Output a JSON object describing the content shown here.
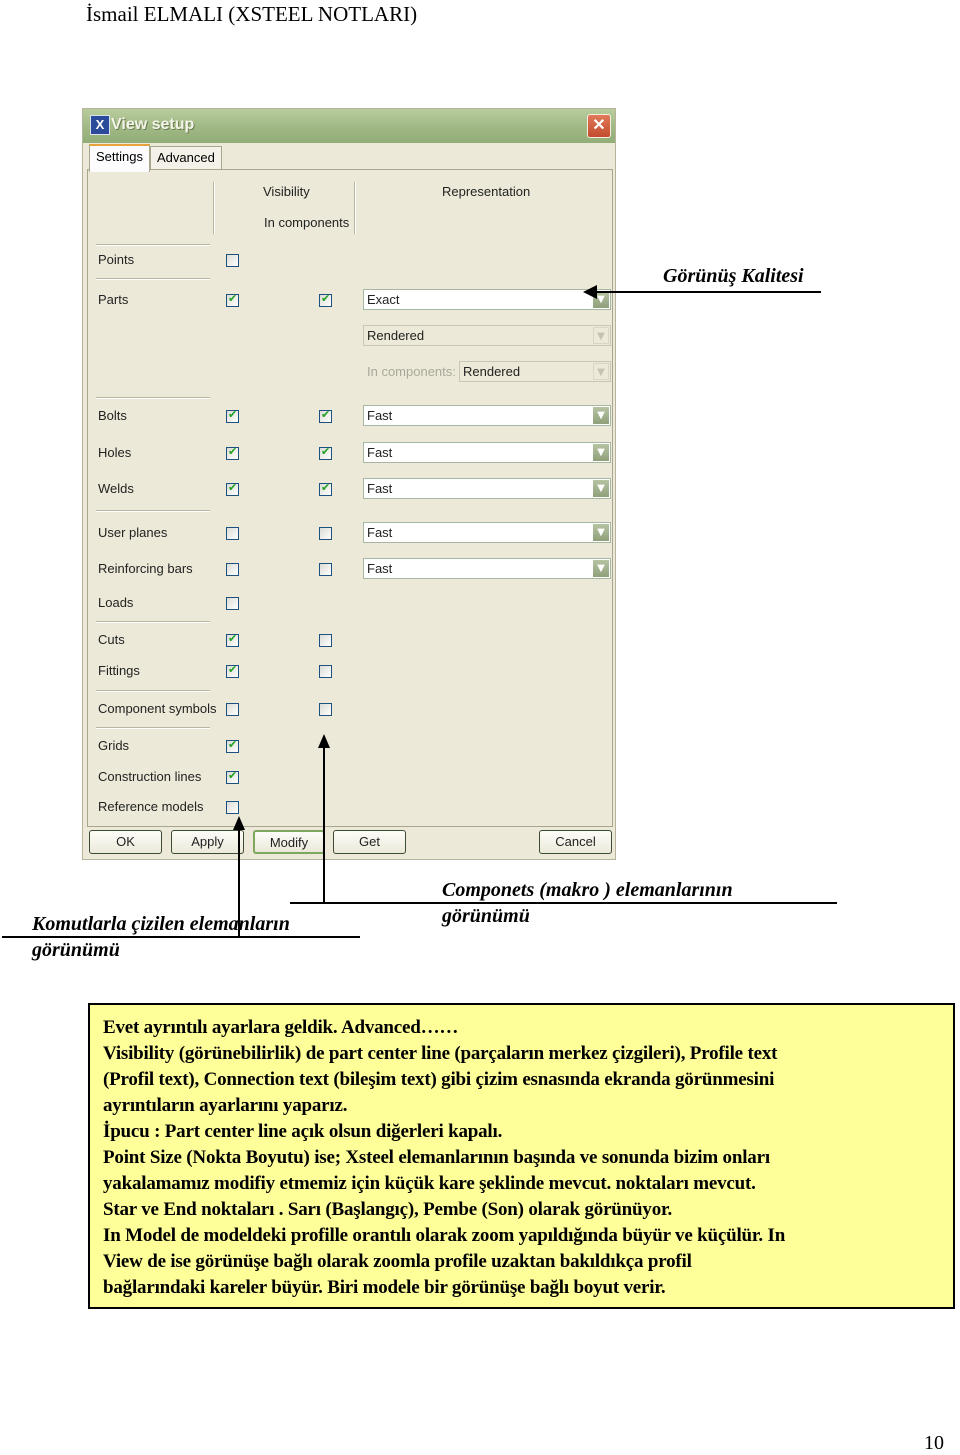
{
  "page": {
    "header": "İsmail ELMALI (XSTEEL NOTLARI)",
    "page_number": "10"
  },
  "dialog": {
    "title": "View setup",
    "app_icon": "xsteel-app-icon",
    "close_glyph": "✕",
    "tabs": [
      {
        "label": "Settings",
        "active": true
      },
      {
        "label": "Advanced",
        "active": false
      }
    ],
    "columns": {
      "visibility": "Visibility",
      "in_components": "In components",
      "representation": "Representation"
    },
    "rows": [
      {
        "label": "Points",
        "visible": false,
        "in_components": null,
        "representation": null
      },
      {
        "label": "Parts",
        "visible": true,
        "in_components": true,
        "representation": "Exact"
      },
      {
        "label": "Bolts",
        "visible": true,
        "in_components": true,
        "representation": "Fast"
      },
      {
        "label": "Holes",
        "visible": true,
        "in_components": true,
        "representation": "Fast"
      },
      {
        "label": "Welds",
        "visible": true,
        "in_components": true,
        "representation": "Fast"
      },
      {
        "label": "User planes",
        "visible": false,
        "in_components": false,
        "representation": "Fast"
      },
      {
        "label": "Reinforcing bars",
        "visible": false,
        "in_components": false,
        "representation": "Fast"
      },
      {
        "label": "Loads",
        "visible": false,
        "in_components": null,
        "representation": null
      },
      {
        "label": "Cuts",
        "visible": true,
        "in_components": false,
        "representation": null
      },
      {
        "label": "Fittings",
        "visible": true,
        "in_components": false,
        "representation": null
      },
      {
        "label": "Component symbols",
        "visible": false,
        "in_components": false,
        "representation": null
      },
      {
        "label": "Grids",
        "visible": true,
        "in_components": null,
        "representation": null
      },
      {
        "label": "Construction lines",
        "visible": true,
        "in_components": null,
        "representation": null
      },
      {
        "label": "Reference models",
        "visible": false,
        "in_components": null,
        "representation": null
      }
    ],
    "parts_rendering": "Rendered",
    "parts_in_components_label": "In components:",
    "parts_in_components_rendering": "Rendered",
    "buttons": {
      "ok": "OK",
      "apply": "Apply",
      "modify": "Modify",
      "get": "Get",
      "cancel": "Cancel"
    },
    "combo_arrow": "▼"
  },
  "annotations": {
    "quality": "Görünüş Kalitesi",
    "components_line1": "Componets (makro ) elemanlarının",
    "components_line2": "görünümü",
    "commands_line1": "Komutlarla çizilen elemanların",
    "commands_line2": "görünümü"
  },
  "note": {
    "lines": [
      "Evet ayrıntılı ayarlara geldik. Advanced……",
      "Visibility (görünebilirlik) de part center line (parçaların merkez çizgileri), Profile text",
      "(Profil text), Connection text (bileşim text) gibi çizim esnasında ekranda görünmesini",
      "ayrıntıların ayarlarını yaparız.",
      "İpucu : Part center line açık olsun diğerleri kapalı.",
      "Point Size (Nokta Boyutu) ise; Xsteel elemanlarının başında ve sonunda bizim onları",
      "yakalamamız modifiy etmemiz için küçük kare şeklinde mevcut. noktaları mevcut.",
      "Star ve End noktaları . Sarı (Başlangıç), Pembe (Son)  olarak görünüyor.",
      "In Model de modeldeki profille orantılı olarak zoom yapıldığında büyür ve küçülür. In",
      "View de ise görünüşe bağlı olarak zoomla profile uzaktan bakıldıkça profil",
      "bağlarındaki kareler büyür. Biri modele bir görünüşe bağlı boyut verir."
    ]
  }
}
